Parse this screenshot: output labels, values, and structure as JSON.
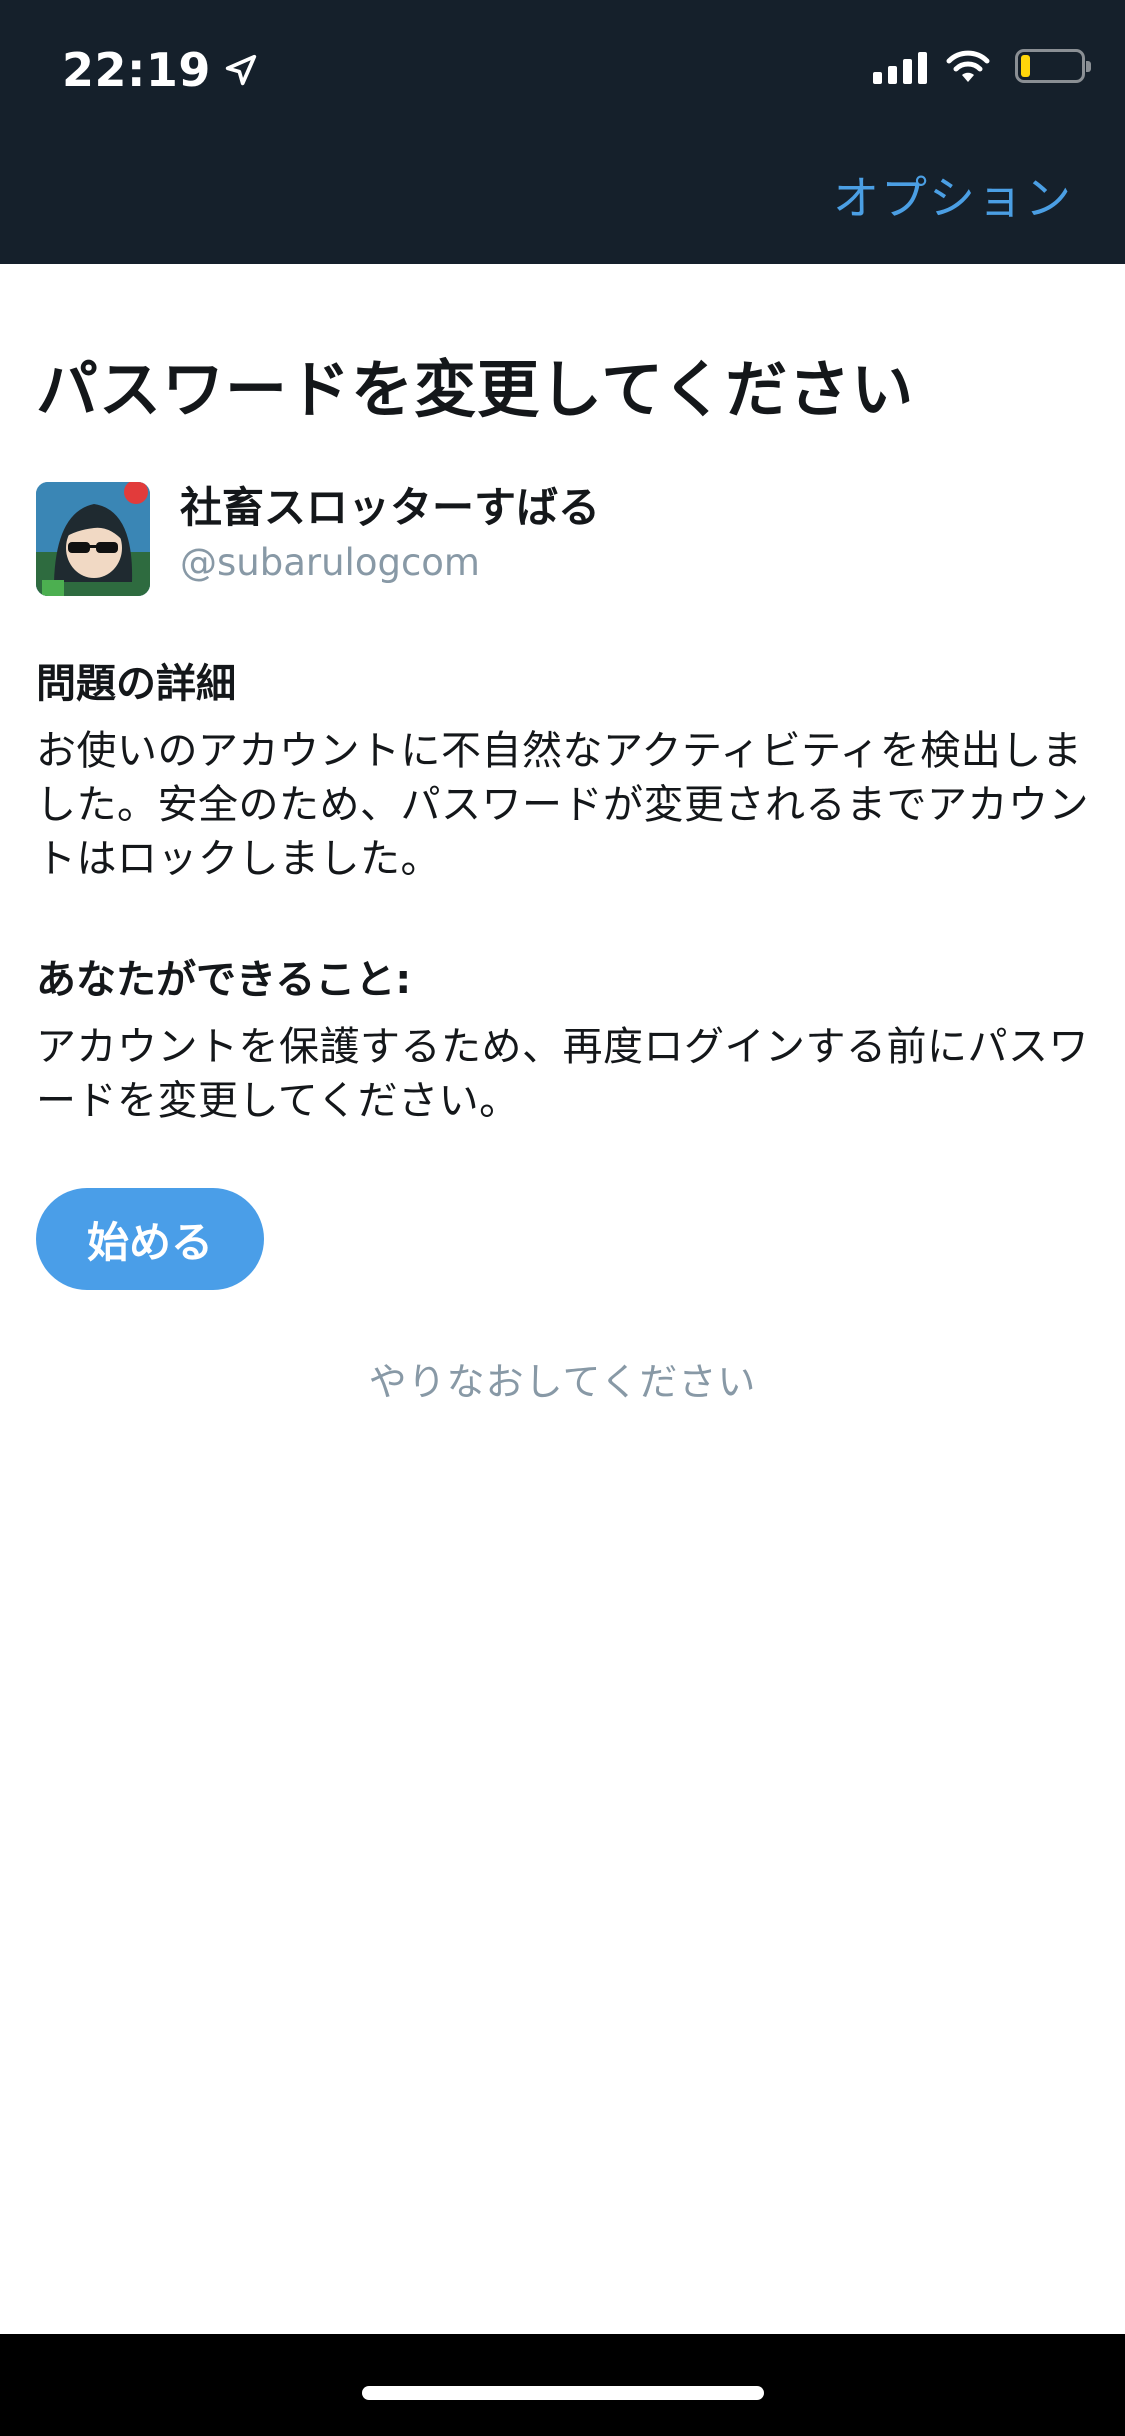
{
  "status_bar": {
    "time": "22:19",
    "icons": [
      "location-arrow-icon",
      "cellular-signal-icon",
      "wifi-icon",
      "battery-icon"
    ],
    "battery_color": "#ffd60a"
  },
  "nav": {
    "options_label": "オプション"
  },
  "page": {
    "title": "パスワードを変更してください"
  },
  "user": {
    "display_name": "社畜スロッターすばる",
    "handle": "@subarulogcom"
  },
  "details": {
    "heading": "問題の詳細",
    "body": "お使いのアカウントに不自然なアクティビティを検出しました。安全のため、パスワードが変更されるまでアカウントはロックしました。"
  },
  "actions": {
    "heading": "あなたができること:",
    "body": "アカウントを保護するため、再度ログインする前にパスワードを変更してください。"
  },
  "buttons": {
    "start_label": "始める",
    "retry_label": "やりなおしてください"
  },
  "colors": {
    "header_bg": "#15202b",
    "accent": "#4a9ee8",
    "secondary_text": "#8899a6"
  }
}
